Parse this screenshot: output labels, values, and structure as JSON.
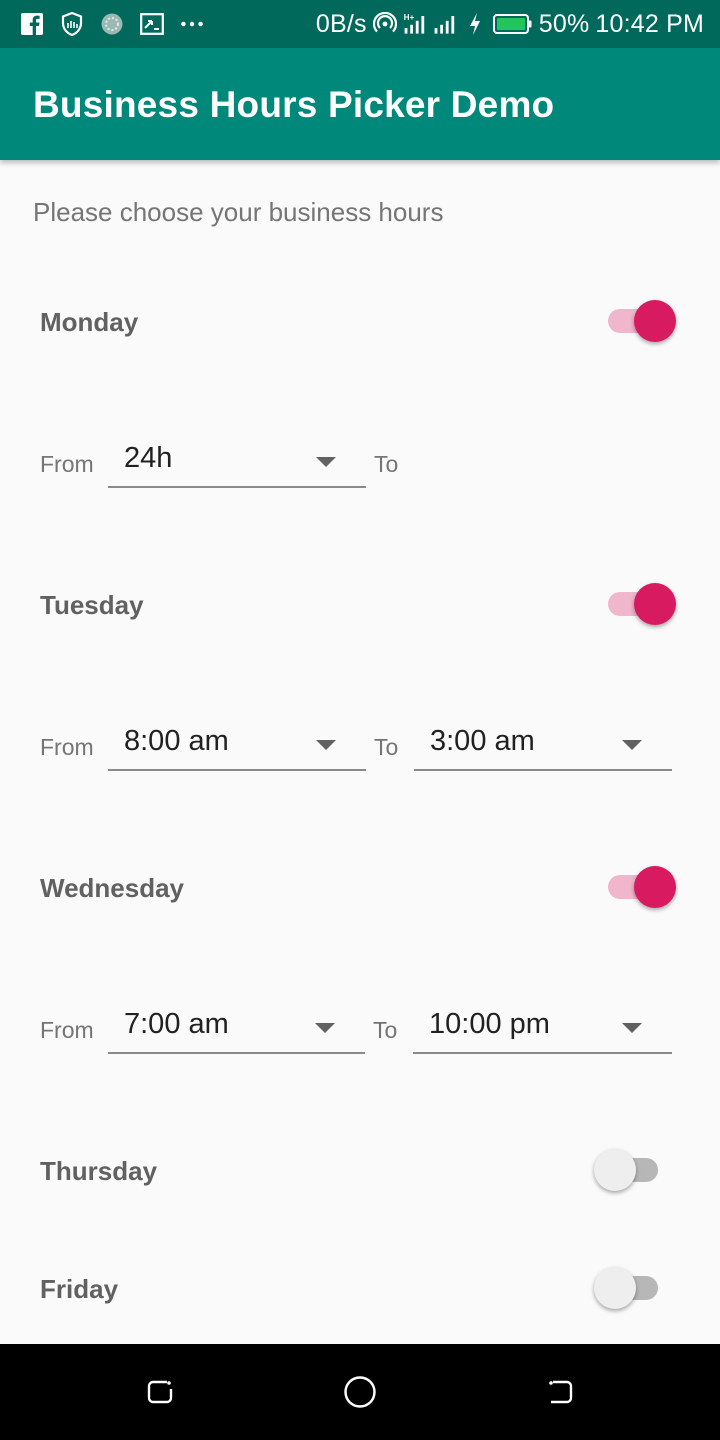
{
  "status_bar": {
    "net_speed": "0B/s",
    "battery": "50%",
    "time": "10:42 PM",
    "icons": [
      "facebook-icon",
      "shield-icon",
      "app-icon",
      "cast-icon",
      "more-icon",
      "hotspot-icon",
      "signal-icon",
      "signal-icon",
      "charging-icon",
      "battery-icon"
    ]
  },
  "app_bar": {
    "title": "Business Hours Picker Demo"
  },
  "subtitle": "Please choose your business hours",
  "labels": {
    "from": "From",
    "to": "To"
  },
  "days": [
    {
      "name": "Monday",
      "enabled": true,
      "from": "24h",
      "to": ""
    },
    {
      "name": "Tuesday",
      "enabled": true,
      "from": "8:00 am",
      "to": "3:00 am"
    },
    {
      "name": "Wednesday",
      "enabled": true,
      "from": "7:00 am",
      "to": "10:00 pm"
    },
    {
      "name": "Thursday",
      "enabled": false
    },
    {
      "name": "Friday",
      "enabled": false
    }
  ],
  "colors": {
    "status_bar": "#00695c",
    "app_bar": "#00897b",
    "switch_on": "#d81b60",
    "switch_on_track": "#f0b6cb",
    "switch_off": "#eeeeee"
  },
  "nav_icons": [
    "recents-icon",
    "home-icon",
    "back-icon"
  ]
}
